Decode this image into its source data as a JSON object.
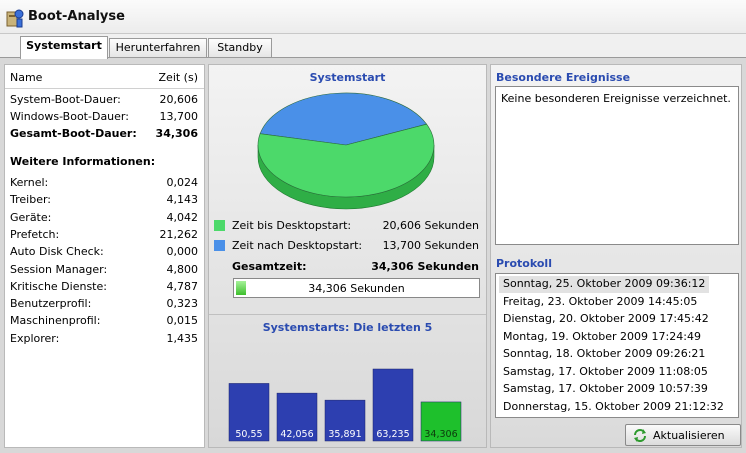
{
  "window": {
    "title": "Boot-Analyse"
  },
  "tabs": [
    "Systemstart",
    "Herunterfahren",
    "Standby"
  ],
  "table": {
    "header": {
      "name": "Name",
      "time": "Zeit (s)"
    },
    "summary": [
      {
        "label": "System-Boot-Dauer:",
        "value": "20,606"
      },
      {
        "label": "Windows-Boot-Dauer:",
        "value": "13,700"
      },
      {
        "label": "Gesamt-Boot-Dauer:",
        "value": "34,306"
      }
    ],
    "more_title": "Weitere Informationen:",
    "details": [
      {
        "label": "Kernel:",
        "value": "0,024"
      },
      {
        "label": "Treiber:",
        "value": "4,143"
      },
      {
        "label": "Geräte:",
        "value": "4,042"
      },
      {
        "label": "Prefetch:",
        "value": "21,262"
      },
      {
        "label": "Auto Disk Check:",
        "value": "0,000"
      },
      {
        "label": "Session Manager:",
        "value": "4,800"
      },
      {
        "label": "Kritische Dienste:",
        "value": "4,787"
      },
      {
        "label": "Benutzerprofil:",
        "value": "0,323"
      },
      {
        "label": "Maschinenprofil:",
        "value": "0,015"
      },
      {
        "label": "Explorer:",
        "value": "1,435"
      }
    ]
  },
  "systemstart": {
    "title": "Systemstart",
    "legend": [
      {
        "label": "Zeit bis Desktopstart:",
        "value": "20,606 Sekunden",
        "color": "#4cd96a"
      },
      {
        "label": "Zeit nach Desktopstart:",
        "value": "13,700 Sekunden",
        "color": "#4a90e8"
      }
    ],
    "total_label": "Gesamtzeit:",
    "total_value": "34,306 Sekunden",
    "progress_text": "34,306 Sekunden",
    "progress_fraction": 0.04
  },
  "recent": {
    "title": "Systemstarts: Die letzten 5"
  },
  "chart_data": [
    {
      "type": "pie",
      "title": "Systemstart",
      "categories": [
        "Zeit bis Desktopstart:",
        "Zeit nach Desktopstart:"
      ],
      "values": [
        20.606,
        13.7
      ],
      "colors": [
        "#4cd96a",
        "#4a90e8"
      ]
    },
    {
      "type": "bar",
      "title": "Systemstarts: Die letzten 5",
      "categories": [
        "",
        "",
        "",
        "",
        ""
      ],
      "values": [
        50.55,
        42.056,
        35.891,
        63.235,
        34.306
      ],
      "labels": [
        "50,55",
        "42,056",
        "35,891",
        "63,235",
        "34,306"
      ],
      "colors": [
        "#2d3fb0",
        "#2d3fb0",
        "#2d3fb0",
        "#2d3fb0",
        "#1ec02c"
      ],
      "ylim": [
        0,
        65
      ]
    }
  ],
  "events": {
    "title": "Besondere Ereignisse",
    "text": "Keine besonderen Ereignisse verzeichnet."
  },
  "protocol": {
    "title": "Protokoll",
    "items": [
      "Sonntag, 25. Oktober 2009 09:36:12",
      "Freitag, 23. Oktober 2009 14:45:05",
      "Dienstag, 20. Oktober 2009 17:45:42",
      "Montag, 19. Oktober 2009 17:24:49",
      "Sonntag, 18. Oktober 2009 09:26:21",
      "Samstag, 17. Oktober 2009 11:08:05",
      "Samstag, 17. Oktober 2009 10:57:39",
      "Donnerstag, 15. Oktober 2009 21:12:32"
    ]
  },
  "refresh_button": {
    "label": "Aktualisieren"
  }
}
